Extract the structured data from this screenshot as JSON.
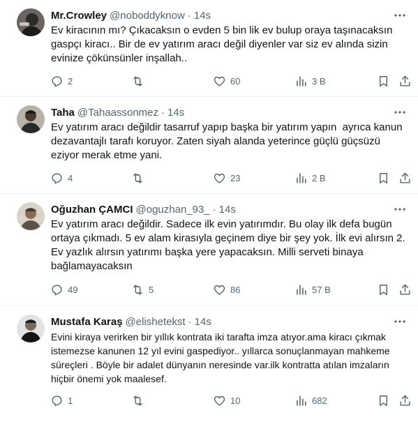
{
  "tweets": [
    {
      "name": "Mr.Crowley",
      "handle": "@noboddyknow",
      "separator": "·",
      "time": "14s",
      "text": "Ev kiracının mı? Çıkacaksın o evden 5 bin lik ev bulup oraya taşınacaksın gaspçı kiracı.. Bir de ev yatırım aracı değil diyenler var siz ev alında sizin evinize çökünsünler inşallah..",
      "replies": "2",
      "retweets": "",
      "likes": "60",
      "views": "3 B"
    },
    {
      "name": "Taha",
      "handle": "@Tahaassonmez",
      "separator": "·",
      "time": "14s",
      "text": "Ev yatırım aracı değildir tasarruf yapıp başka bir yatırım yapın  ayrıca kanun dezavantajlı tarafı koruyor. Zaten siyah alanda yeterince güçlü güçsüzü eziyor merak etme yani.",
      "replies": "4",
      "retweets": "",
      "likes": "23",
      "views": "2 B"
    },
    {
      "name": "Oğuzhan ÇAMCI",
      "handle": "@oguzhan_93_",
      "separator": "·",
      "time": "14s",
      "text": "Ev yatırım aracı değildir. Sadece ilk evin yatırımdır. Bu olay ilk defa bugün ortaya çıkmadı. 5 ev alam kirasıyla geçinem diye bir şey yok. İlk evi alırsın 2. Ev yazlık alırsın yatırımı başka yere yapacaksın. Milli serveti binaya bağlamayacaksın",
      "replies": "49",
      "retweets": "5",
      "likes": "86",
      "views": "57 B"
    },
    {
      "name": "Mustafa Karaş",
      "handle": "@elishetekst",
      "separator": "·",
      "time": "14s",
      "text": "Evini kiraya verirken bir yıllık kontrata iki tarafta imza atıyor.ama kiracı çıkmak istemezse kanunen 12 yıl evini gaspediyor.. yıllarca sonuçlanmayan mahkeme süreçleri . Böyle bir adalet dünyanın neresinde var.ilk kontratta atılan imzaların hiçbir önemi yok maalesef.",
      "replies": "1",
      "retweets": "",
      "likes": "10",
      "views": "682"
    }
  ],
  "colors": {
    "text": "#0f1419",
    "secondary": "#536471",
    "divider": "#eff3f4"
  },
  "icons": [
    "more-icon",
    "reply-icon",
    "retweet-icon",
    "like-icon",
    "views-icon",
    "bookmark-icon",
    "share-icon"
  ]
}
